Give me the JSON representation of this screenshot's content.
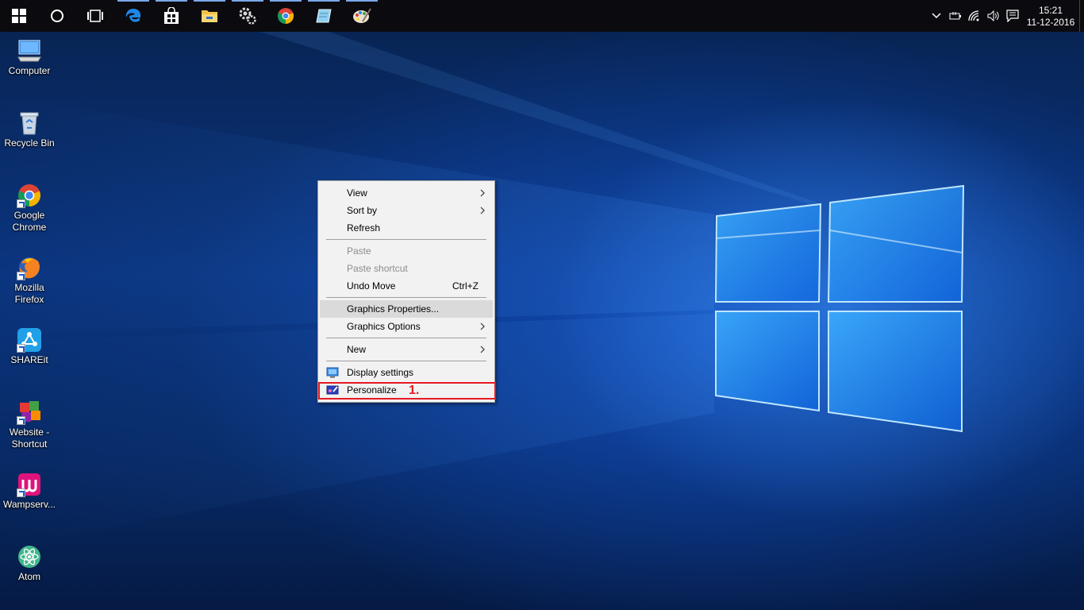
{
  "taskbar": {
    "apps": [
      {
        "name": "start-button",
        "icon": "windows-logo-icon"
      },
      {
        "name": "cortana-button",
        "icon": "cortana-circle-icon"
      },
      {
        "name": "task-view-button",
        "icon": "task-view-icon"
      },
      {
        "name": "edge-app",
        "icon": "edge-icon"
      },
      {
        "name": "store-app",
        "icon": "store-icon"
      },
      {
        "name": "file-explorer-app",
        "icon": "folder-icon"
      },
      {
        "name": "settings-app",
        "icon": "gear-icon"
      },
      {
        "name": "chrome-app",
        "icon": "chrome-icon"
      },
      {
        "name": "notepad-app",
        "icon": "notepad-icon"
      },
      {
        "name": "paint-app",
        "icon": "paint-palette-icon"
      }
    ],
    "clock": {
      "time": "15:21",
      "date": "11-12-2016"
    }
  },
  "desktop_icons": [
    {
      "label": "Computer",
      "icon": "computer-icon"
    },
    {
      "label": "Recycle Bin",
      "icon": "recycle-bin-icon"
    },
    {
      "label": "Google Chrome",
      "icon": "chrome-icon"
    },
    {
      "label": "Mozilla Firefox",
      "icon": "firefox-icon"
    },
    {
      "label": "SHAREit",
      "icon": "shareit-icon"
    },
    {
      "label": "Website - Shortcut",
      "icon": "website-shortcut-icon"
    },
    {
      "label": "Wampserv...",
      "icon": "wampserver-icon"
    },
    {
      "label": "Atom",
      "icon": "atom-icon"
    }
  ],
  "context_menu": {
    "view": "View",
    "sort_by": "Sort by",
    "refresh": "Refresh",
    "paste": "Paste",
    "paste_shortcut": "Paste shortcut",
    "undo_move": "Undo Move",
    "undo_move_shortcut": "Ctrl+Z",
    "graphics_properties": "Graphics Properties...",
    "graphics_options": "Graphics Options",
    "new": "New",
    "display_settings": "Display settings",
    "personalize": "Personalize"
  },
  "annotation": {
    "step_label": "1.",
    "color": "#e51a24"
  },
  "colors": {
    "taskbar": "#0b0b0f",
    "menu_bg": "#f2f2f2",
    "hover": "#dadada",
    "accent": "#1a5fd0"
  }
}
